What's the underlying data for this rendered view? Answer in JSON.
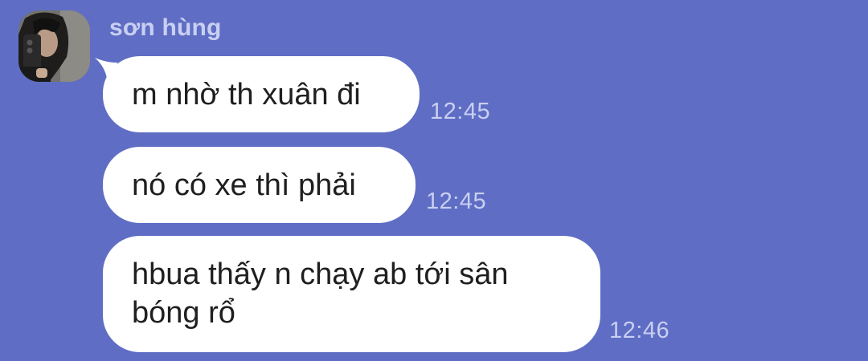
{
  "conversation": {
    "sender_name": "sơn hùng",
    "messages": [
      {
        "text": "m nhờ th xuân đi",
        "time": "12:45"
      },
      {
        "text": "nó có xe thì phải",
        "time": "12:45"
      },
      {
        "text": "hbua thấy n chạy ab tới sân bóng rổ",
        "time": "12:46"
      }
    ]
  },
  "colors": {
    "background": "#5f6ec4",
    "bubble": "#ffffff",
    "meta_text": "#c9cff2"
  },
  "icons": {
    "avatar": "profile-photo"
  }
}
